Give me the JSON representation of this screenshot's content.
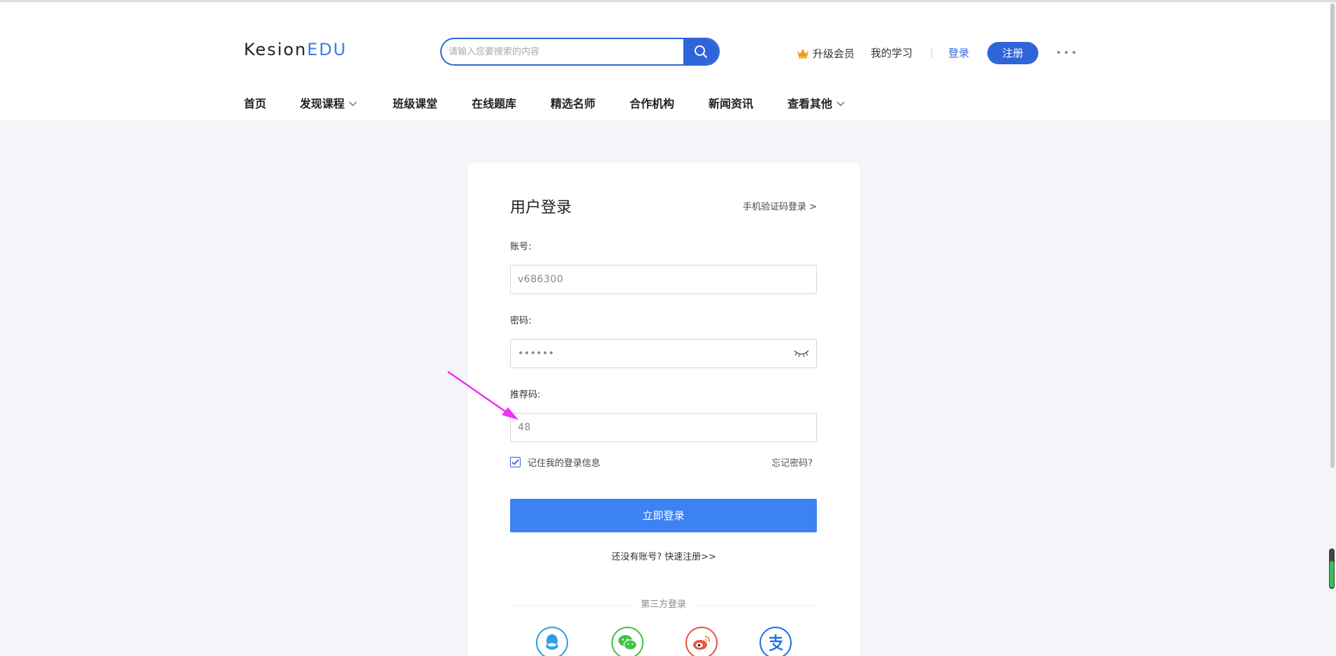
{
  "header": {
    "logo_main": "Kesion",
    "logo_accent": "EDU",
    "search_placeholder": "请输入您要搜索的内容",
    "vip_label": "升级会员",
    "my_learning": "我的学习",
    "login": "登录",
    "register": "注册"
  },
  "nav": {
    "items": [
      {
        "label": "首页",
        "dropdown": false
      },
      {
        "label": "发现课程",
        "dropdown": true
      },
      {
        "label": "班级课堂",
        "dropdown": false
      },
      {
        "label": "在线题库",
        "dropdown": false
      },
      {
        "label": "精选名师",
        "dropdown": false
      },
      {
        "label": "合作机构",
        "dropdown": false
      },
      {
        "label": "新闻资讯",
        "dropdown": false
      },
      {
        "label": "查看其他",
        "dropdown": true
      }
    ]
  },
  "login_form": {
    "title": "用户登录",
    "sms_login": "手机验证码登录 >",
    "account_label": "账号:",
    "account_value": "v686300",
    "password_label": "密码:",
    "password_value": "••••••",
    "referral_label": "推荐码:",
    "referral_value": "48",
    "remember_label": "记住我的登录信息",
    "remember_checked": true,
    "forgot": "忘记密码?",
    "submit": "立即登录",
    "no_account": "还没有账号? 快速注册>>",
    "third_party": "第三方登录",
    "social": [
      "qq-icon",
      "wechat-icon",
      "weibo-icon",
      "alipay-icon"
    ]
  },
  "colors": {
    "primary": "#2f65d8",
    "button": "#3d82f2",
    "annotation_arrow": "#f02ff0",
    "qq": "#2ba0e8",
    "wechat": "#3fc43f",
    "weibo": "#e8573f",
    "alipay": "#1a73e8"
  }
}
